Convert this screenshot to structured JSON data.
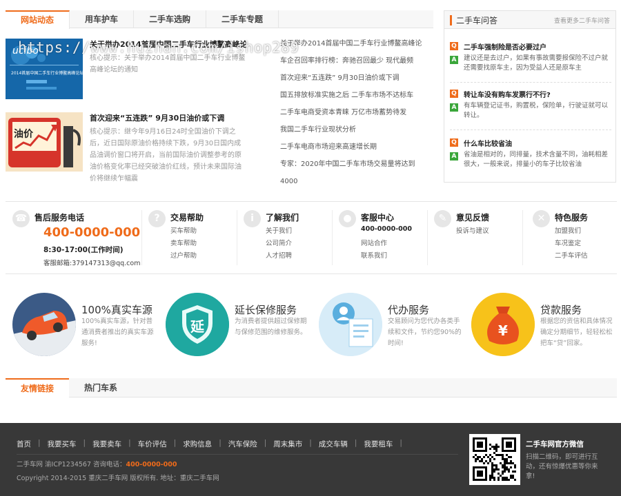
{
  "news": {
    "tabs": [
      "网站动态",
      "用车护车",
      "二手车选购",
      "二手车专题"
    ],
    "featured": [
      {
        "title": "关于举办2014首届中国二手车行业博鳌高峰论",
        "desc": "核心提示：关于举办2014首届中国二手车行业博鳌高峰论坛的通知",
        "thumb_text": "2014首届中国二手车行业博鳌高峰论坛"
      },
      {
        "title": "首次迎来“五连跌” 9月30日油价或下调",
        "desc": "核心提示：继今年9月16日24时全国油价下调之后，近日国际原油价格持续下跌，9月30日国内成品油调价窗口将开启，当前国际油价调整参考的原油价格变化率已经突破油价红线，预计未来国际油价将继续乍幅震",
        "thumb_text": "油价"
      }
    ],
    "list": [
      "关于举办2014首届中国二手车行业博鳌高峰论",
      "车企召回率排行榜：奔驰召回最少 现代最频",
      "首次迎来“五连跌” 9月30日油价或下调",
      "国五排放标准实施之后 二手车市场不达标车",
      "二手车电商受资本青睐 万亿市场蓄势待发",
      "我国二手车行业现状分析",
      "二手车电商市场迎来高速增长期",
      "专家：2020年中国二手车市场交易量将达到",
      "4000"
    ],
    "watermark": "https://www.huzhan.com/ishop289"
  },
  "qa": {
    "title": "二手车问答",
    "more": "查看更多二手车问答",
    "items": [
      {
        "q": "二手车强制险是否必要过户",
        "a": "建议还是去过户，如果有事故需要报保险不过户就还需要找原车主，因为受益人还是原车主"
      },
      {
        "q": "转让车没有购车发票行不行?",
        "a": "有车辆登记证书，购置税，保险单，行驶证就可以转让。"
      },
      {
        "q": "什么车比较省油",
        "a": "省油是相对的，同排量，技术含量不同，油耗相差很大，一般来说，排量小的车子比较省油"
      }
    ]
  },
  "services": {
    "after_sales": {
      "title": "售后服务电话",
      "phone": "400-0000-000",
      "hours": "8:30-17:00(工作时间)",
      "email": "客服邮箱:379147313@qq.com"
    },
    "groups": [
      {
        "title": "交易帮助",
        "links": [
          "买车帮助",
          "卖车帮助",
          "过户帮助"
        ]
      },
      {
        "title": "了解我们",
        "links": [
          "关于我们",
          "公司简介",
          "人才招聘"
        ]
      },
      {
        "title": "客服中心",
        "links": [
          "400-0000-000",
          "网站合作",
          "联系我们"
        ]
      },
      {
        "title": "意见反馈",
        "links": [
          "投诉与建议"
        ]
      },
      {
        "title": "特色服务",
        "links": [
          "加盟我们",
          "车况鉴定",
          "二手车评估"
        ]
      }
    ]
  },
  "features": [
    {
      "title": "100%真实车源",
      "desc": "100%真实车源，针对普通消费者推出的真实车源服务!"
    },
    {
      "title": "延长保修服务",
      "desc": "为消费者提供超过保修期与保修范围的维修服务。",
      "icon_char": "延"
    },
    {
      "title": "代办服务",
      "desc": "交易顾问为您代办各类手续和文件，节约您90%的时间!"
    },
    {
      "title": "贷款服务",
      "desc": "根据您的资信和具体情况确定分期细节，轻轻松松把车“贷”回家。",
      "icon_char": "¥"
    }
  ],
  "links_tabs": [
    "友情链接",
    "热门车系"
  ],
  "footer": {
    "nav": [
      "首页",
      "我要买车",
      "我要卖车",
      "车价评估",
      "求购信息",
      "汽车保险",
      "周末集市",
      "成交车辆",
      "我要租车"
    ],
    "info_prefix": "二手车网   渝ICP1234567   咨询电话：",
    "info_phone": "400-0000-000",
    "copyright": "Copyright 2014-2015 重庆二手车网 版权所有.   地址：重庆二手车网",
    "wechat_title": "二手车网官方微信",
    "wechat_desc": "扫描二维码，即可进行互动，还有惊爆优惠等你来拿!"
  },
  "colors": {
    "accent": "#ef6b1a",
    "answer": "#3aa63a",
    "footer_bg": "#383838"
  }
}
